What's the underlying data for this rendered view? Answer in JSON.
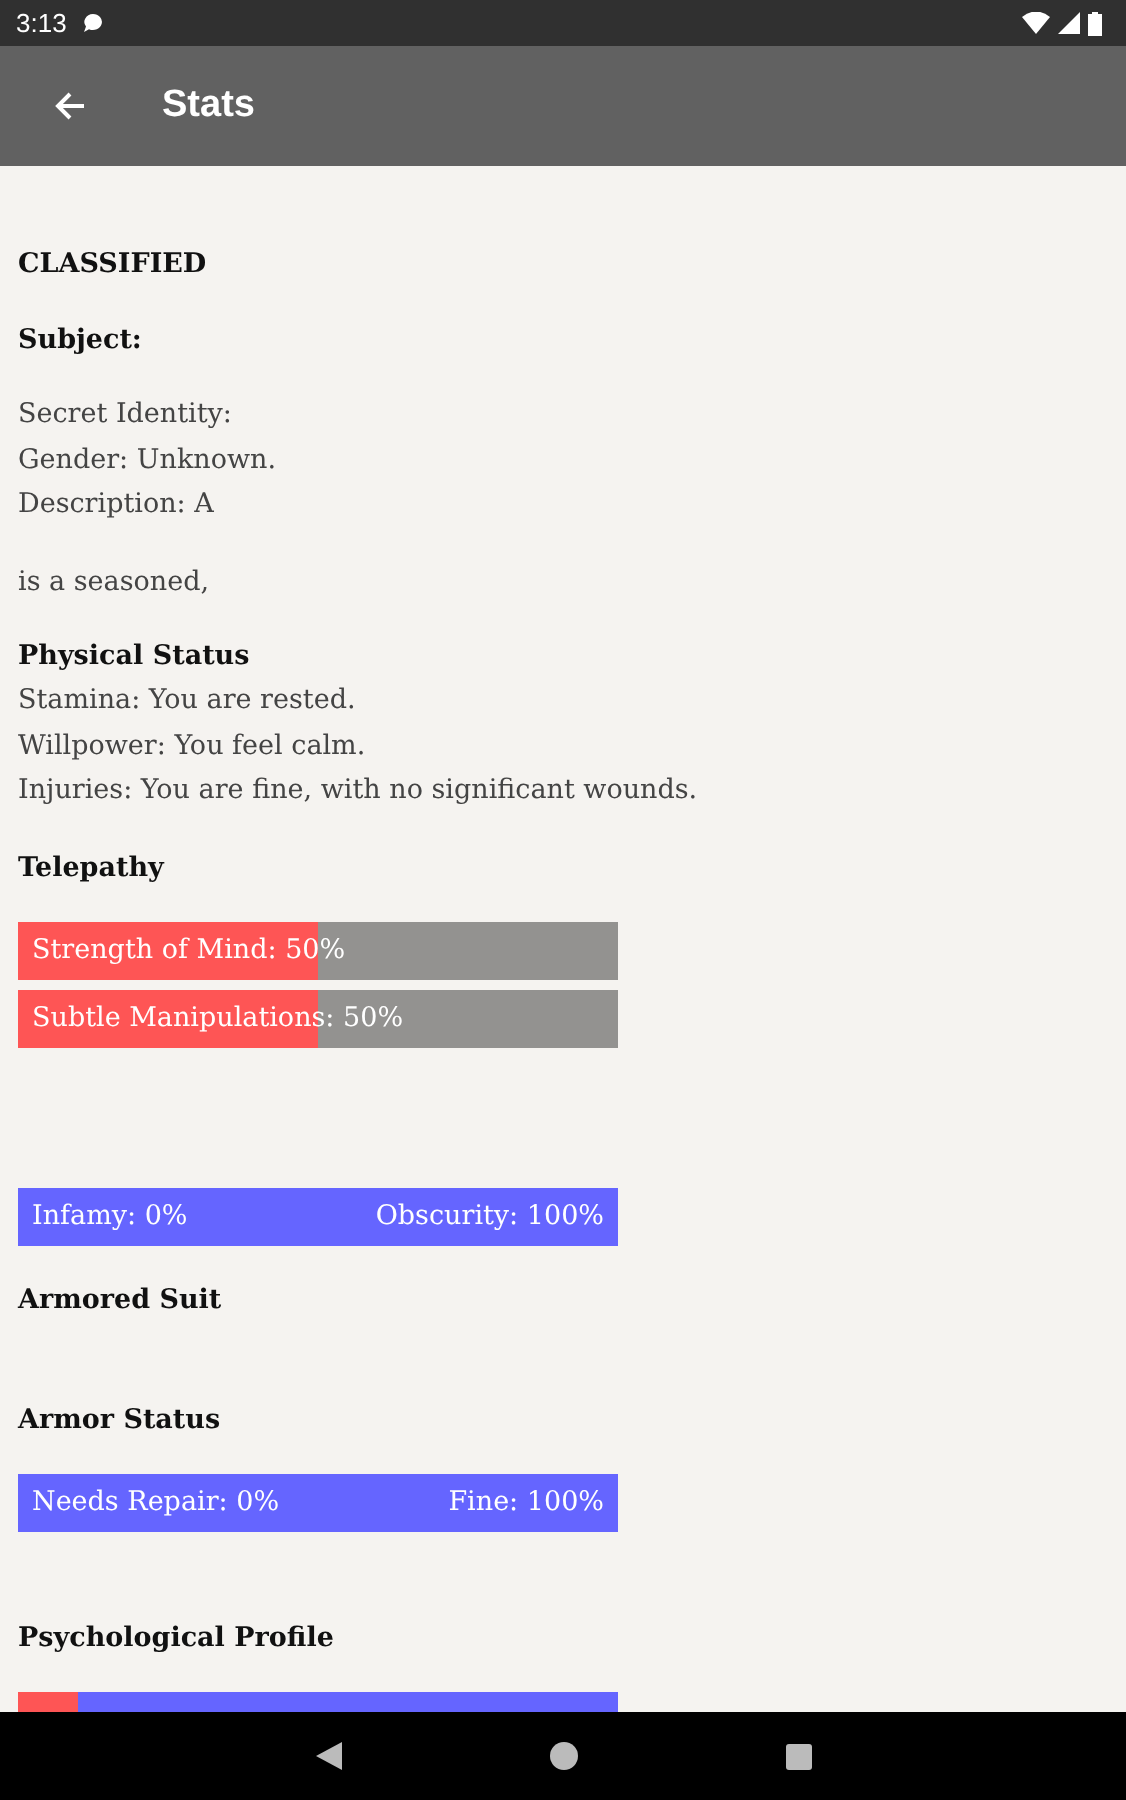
{
  "status_bar": {
    "time": "3:13"
  },
  "app_bar": {
    "title": "Stats"
  },
  "blocks": [
    {
      "kind": "heading",
      "text": "CLASSIFIED"
    },
    {
      "kind": "heading",
      "text": "Subject:"
    },
    {
      "kind": "paragraph",
      "lines": [
        "Secret Identity:",
        "Gender: Unknown.",
        "Description: A"
      ]
    },
    {
      "kind": "paragraph",
      "lines": [
        "is a seasoned,"
      ]
    },
    {
      "kind": "heading",
      "text": "Physical Status"
    },
    {
      "kind": "paragraph",
      "lines": [
        "Stamina: You are rested.",
        "Willpower: You feel calm.",
        "Injuries: You are fine, with no significant wounds."
      ]
    },
    {
      "kind": "heading",
      "text": "Telepathy"
    },
    {
      "kind": "bar",
      "label": "Strength of Mind: 50%",
      "level": 0.5
    },
    {
      "kind": "bar",
      "label": "Subtle Manipulations: 50%",
      "level": 0.5
    },
    {
      "kind": "opposed",
      "left": "Infamy: 0%",
      "right": "Obscurity: 100%",
      "level": 0
    },
    {
      "kind": "heading",
      "text": "Armored Suit"
    },
    {
      "kind": "heading",
      "text": "Armor Status"
    },
    {
      "kind": "opposed",
      "left": "Needs Repair: 0%",
      "right": "Fine: 100%",
      "level": 0
    },
    {
      "kind": "heading",
      "text": "Psychological Profile"
    },
    {
      "kind": "opposed",
      "level": 0.1
    }
  ]
}
